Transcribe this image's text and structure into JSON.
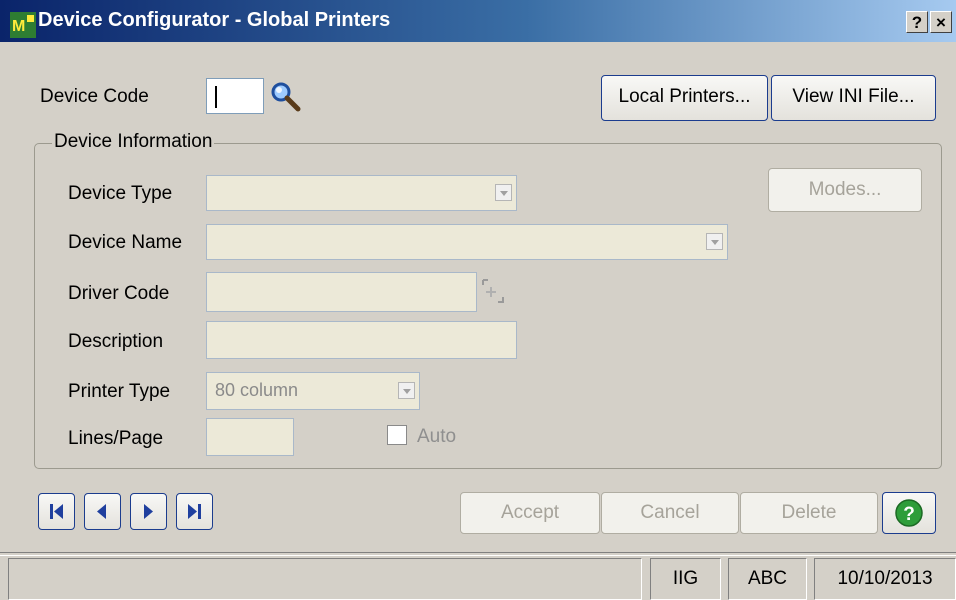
{
  "window": {
    "title": "Device Configurator - Global Printers",
    "help_btn": "?",
    "close_btn": "×",
    "app_icon": "app-logo-icon"
  },
  "header": {
    "device_code_label": "Device Code",
    "device_code_value": "",
    "lookup_icon": "magnifier-icon",
    "local_printers": "Local Printers...",
    "view_ini": "View INI File..."
  },
  "device_info": {
    "group_title": "Device Information",
    "device_type_label": "Device Type",
    "device_type_value": "",
    "device_name_label": "Device Name",
    "device_name_value": "",
    "driver_code_label": "Driver Code",
    "driver_code_value": "",
    "description_label": "Description",
    "description_value": "",
    "printer_type_label": "Printer Type",
    "printer_type_value": "80 column",
    "lines_page_label": "Lines/Page",
    "lines_page_value": "",
    "auto_label": "Auto",
    "auto_checked": false,
    "modes_button": "Modes..."
  },
  "nav": {
    "icons": [
      "first-record-icon",
      "previous-record-icon",
      "next-record-icon",
      "last-record-icon"
    ]
  },
  "actions": {
    "accept": "Accept",
    "cancel": "Cancel",
    "delete": "Delete",
    "help_icon": "help-icon"
  },
  "status_bar": {
    "message": "",
    "company_user": "IIG",
    "company_code": "ABC",
    "date": "10/10/2013"
  }
}
